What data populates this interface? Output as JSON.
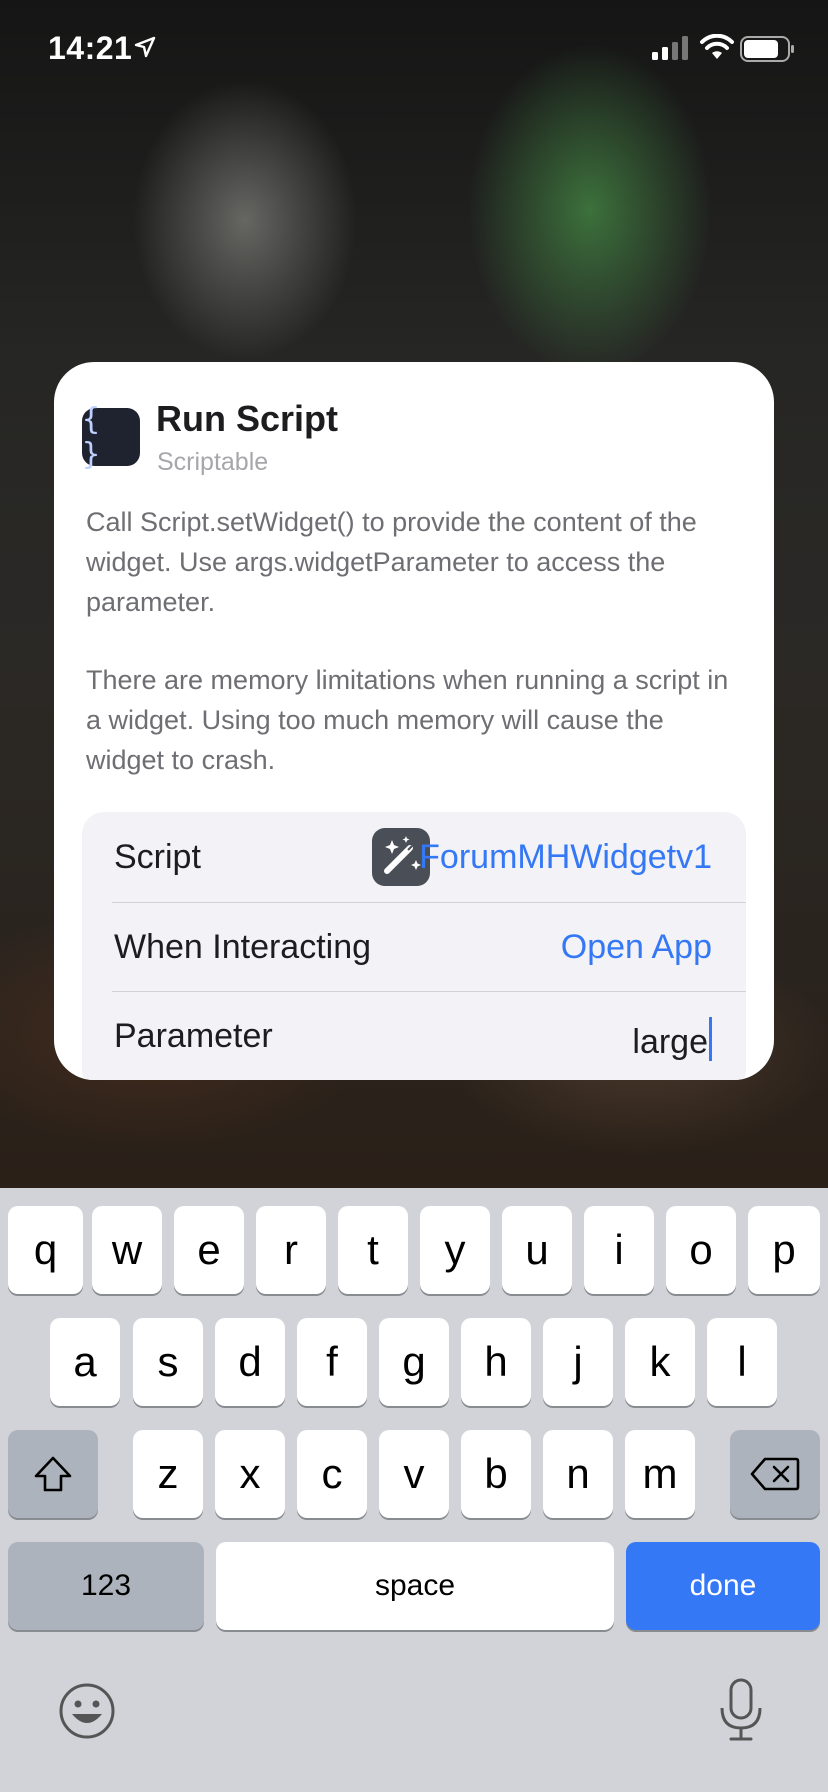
{
  "status_bar": {
    "time": "14:21",
    "icons": [
      "location-arrow-icon",
      "cellular-signal-icon",
      "wifi-icon",
      "battery-icon"
    ]
  },
  "card": {
    "app_icon_glyph": "{ }",
    "title": "Run Script",
    "subtitle": "Scriptable",
    "description_1": "Call Script.setWidget() to provide the content of the widget. Use args.widgetParameter to access the parameter.",
    "description_2": "There are memory limitations when running a script in a widget. Using too much memory will cause the  widget to crash.",
    "rows": {
      "script": {
        "label": "Script",
        "value": "ForumMHWidgetv1",
        "icon": "magic-wand-icon"
      },
      "when_interacting": {
        "label": "When Interacting",
        "value": "Open App"
      },
      "parameter": {
        "label": "Parameter",
        "value": "large"
      }
    }
  },
  "keyboard": {
    "row1": [
      "q",
      "w",
      "e",
      "r",
      "t",
      "y",
      "u",
      "i",
      "o",
      "p"
    ],
    "row2": [
      "a",
      "s",
      "d",
      "f",
      "g",
      "h",
      "j",
      "k",
      "l"
    ],
    "row3": [
      "z",
      "x",
      "c",
      "v",
      "b",
      "n",
      "m"
    ],
    "numbers_label": "123",
    "space_label": "space",
    "done_label": "done",
    "icons": [
      "shift-icon",
      "delete-icon",
      "emoji-icon",
      "microphone-icon"
    ]
  },
  "colors": {
    "accent": "#3478f6",
    "keyboard_bg": "#d1d3d9",
    "card_bg": "#ffffff"
  }
}
